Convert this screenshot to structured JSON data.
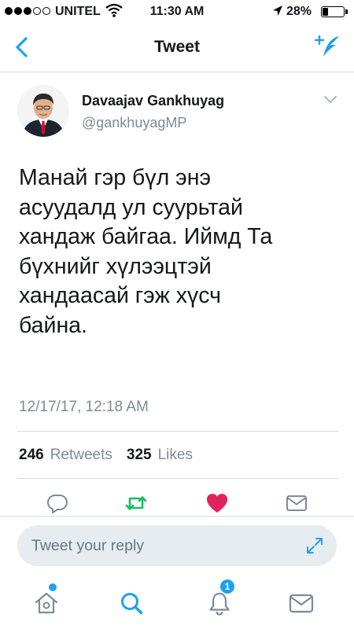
{
  "status_bar": {
    "carrier": "UNITEL",
    "time": "11:30 AM",
    "battery_percent": "28%",
    "battery_level": 0.28,
    "signal_bars_filled": 3,
    "signal_bars_total": 5
  },
  "nav": {
    "title": "Tweet",
    "back_icon": "chevron-left-icon",
    "compose_icon": "compose-tweet-icon"
  },
  "tweet": {
    "display_name": "Davaajav Gankhuyag",
    "handle": "@gankhuyagMP",
    "text_lines": [
      "Манай гэр бүл энэ",
      "асуудалд ул суурьтай",
      "хандаж байгаа. Иймд Та",
      "бүхнийг хүлээцтэй",
      "хандаасай гэж хүсч",
      "байна."
    ],
    "timestamp": "12/17/17, 12:18 AM",
    "retweets_count": "246",
    "retweets_label": "Retweets",
    "likes_count": "325",
    "likes_label": "Likes",
    "liked": true
  },
  "actions": [
    "reply-icon",
    "retweet-icon",
    "like-icon",
    "direct-message-icon"
  ],
  "reply": {
    "placeholder": "Tweet your reply",
    "expand_icon": "expand-icon"
  },
  "tabbar": {
    "home_has_new": true,
    "notifications_badge": "1"
  },
  "colors": {
    "accent": "#1da1f2",
    "like": "#e0245e",
    "retweet": "#17bf63",
    "secondary_text": "#7c8b97",
    "divider": "#d6dbe0"
  }
}
